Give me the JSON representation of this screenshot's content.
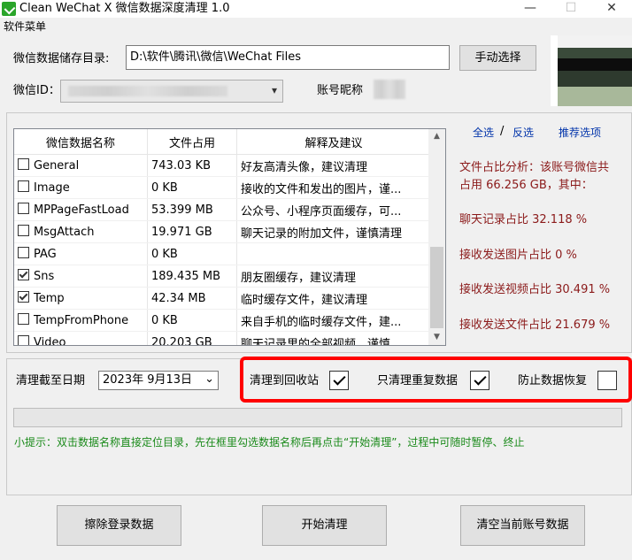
{
  "window": {
    "title": "Clean WeChat X 微信数据深度清理 1.0",
    "minimize": "—",
    "maximize": "☐",
    "close": "✕"
  },
  "menu": {
    "software_menu": "软件菜单"
  },
  "storage": {
    "label": "微信数据储存目录:",
    "path": "D:\\软件\\腾讯\\微信\\WeChat Files",
    "manual_select": "手动选择"
  },
  "account": {
    "wechat_id_label": "微信ID：",
    "nickname_label": "账号昵称"
  },
  "table": {
    "headers": [
      "微信数据名称",
      "文件占用",
      "解释及建议"
    ],
    "rows": [
      {
        "name": "General",
        "size": "743.03 KB",
        "note": "好友高清头像，建议清理",
        "checked": false
      },
      {
        "name": "Image",
        "size": "0 KB",
        "note": "接收的文件和发出的图片，谨...",
        "checked": false
      },
      {
        "name": "MPPageFastLoad",
        "size": "53.399 MB",
        "note": "公众号、小程序页面缓存，可...",
        "checked": false
      },
      {
        "name": "MsgAttach",
        "size": "19.971 GB",
        "note": "聊天记录的附加文件，谨慎清理",
        "checked": false
      },
      {
        "name": "PAG",
        "size": "0 KB",
        "note": "",
        "checked": false
      },
      {
        "name": "Sns",
        "size": "189.435 MB",
        "note": "朋友圈缓存，建议清理",
        "checked": true
      },
      {
        "name": "Temp",
        "size": "42.34 MB",
        "note": "临时缓存文件，建议清理",
        "checked": true
      },
      {
        "name": "TempFromPhone",
        "size": "0 KB",
        "note": "来自手机的临时缓存文件，建...",
        "checked": false
      },
      {
        "name": "Video",
        "size": "20.203 GB",
        "note": "聊天记录里的全部视频，谨慎...",
        "checked": false
      }
    ]
  },
  "selection": {
    "select_all": "全选",
    "separator": "/",
    "invert": "反选",
    "recommended": "推荐选项"
  },
  "analysis": {
    "line1": "文件占比分析：该账号微信共",
    "line2": "占用 66.256 GB，其中：",
    "chat": "聊天记录占比 32.118 %",
    "images": "接收发送图片占比 0 %",
    "videos": "接收发送视频占比 30.491 %",
    "files": "接收发送文件占比 21.679 %"
  },
  "options": {
    "date_label": "清理截至日期",
    "date_value": "2023年  9月13日",
    "recycle_label": "清理到回收站",
    "recycle_checked": true,
    "dup_label": "只清理重复数据",
    "dup_checked": true,
    "prevent_label": "防止数据恢复",
    "prevent_checked": false
  },
  "progress": {
    "value": 0
  },
  "tip": "小提示：双击数据名称直接定位目录，先在框里勾选数据名称后再点击“开始清理”，过程中可随时暂停、终止",
  "buttons": {
    "erase_login": "擦除登录数据",
    "start_clean": "开始清理",
    "clear_account": "清空当前账号数据"
  },
  "icons": {
    "dropdown": "▾",
    "scroll_up": "▲",
    "scroll_down": "▼",
    "calendar_arrow": "⌄"
  }
}
